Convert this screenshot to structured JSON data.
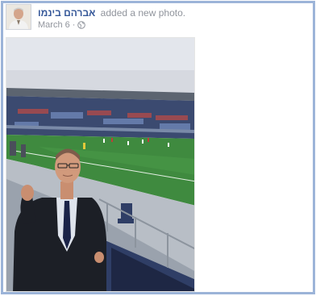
{
  "post": {
    "author_name": "אברהם בינמו",
    "action_text": "added a new photo.",
    "date": "March 6",
    "separator": "·",
    "privacy_icon": "globe-icon",
    "avatar_icon": "avatar-icon"
  },
  "photo": {
    "subject": "photo-stadium-man"
  },
  "colors": {
    "frame_border": "#9cb4d8",
    "author_link": "#365899",
    "meta_text": "#90949c",
    "background": "#ffffff"
  }
}
